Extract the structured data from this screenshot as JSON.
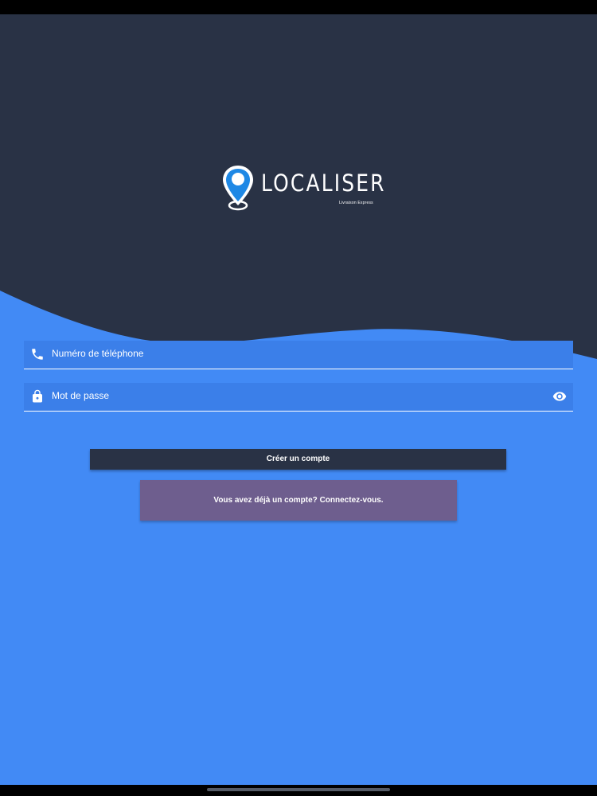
{
  "colors": {
    "header_background": "#293245",
    "body_background": "#428af5",
    "field_background": "#3b7fe9",
    "create_button_background": "#293245",
    "login_button_background": "#6e5e8e",
    "logo_pin": "#1e88e5",
    "text": "#ffffff"
  },
  "logo": {
    "name": "LOCALISER",
    "tagline": "Livraison Express",
    "icon": "map-pin-icon"
  },
  "form": {
    "phone": {
      "label": "Numéro de téléphone",
      "icon": "phone-icon"
    },
    "password": {
      "label": "Mot de passe",
      "icon": "lock-icon",
      "toggle_icon": "eye-icon"
    }
  },
  "buttons": {
    "create_account": "Créer un compte",
    "login_link": "Vous avez déjà un compte? Connectez-vous."
  }
}
